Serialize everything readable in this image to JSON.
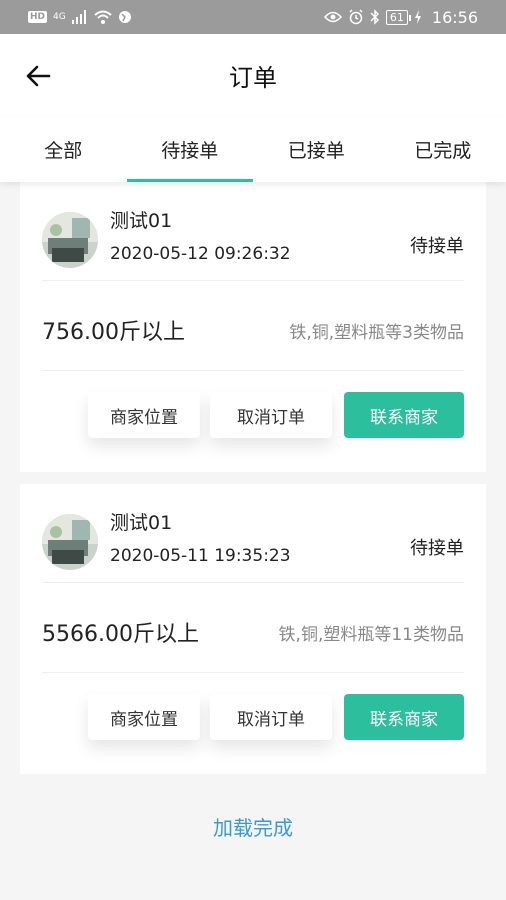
{
  "status_bar": {
    "left_badge": "HD",
    "network": "4G",
    "battery": "61",
    "time": "16:56",
    "icons": [
      "signal-icon",
      "wifi-icon",
      "globe-icon",
      "eye-icon",
      "alarm-icon",
      "bluetooth-icon",
      "charging-icon"
    ]
  },
  "header": {
    "title": "订单",
    "back_icon": "arrow-left-icon"
  },
  "tabs": [
    {
      "label": "全部",
      "active": false
    },
    {
      "label": "待接单",
      "active": true
    },
    {
      "label": "已接单",
      "active": false
    },
    {
      "label": "已完成",
      "active": false
    }
  ],
  "colors": {
    "accent": "#2bbf9e",
    "link": "#3a9ad9",
    "muted_text": "#888888"
  },
  "orders": [
    {
      "shop_name": "测试01",
      "time": "2020-05-12 09:26:32",
      "status": "待接单",
      "weight": "756.00斤以上",
      "items": "铁,铜,塑料瓶等3类物品",
      "buttons": {
        "location": "商家位置",
        "cancel": "取消订单",
        "contact": "联系商家"
      }
    },
    {
      "shop_name": "测试01",
      "time": "2020-05-11 19:35:23",
      "status": "待接单",
      "weight": "5566.00斤以上",
      "items": "铁,铜,塑料瓶等11类物品",
      "buttons": {
        "location": "商家位置",
        "cancel": "取消订单",
        "contact": "联系商家"
      }
    }
  ],
  "footer": {
    "load_status": "加载完成"
  }
}
